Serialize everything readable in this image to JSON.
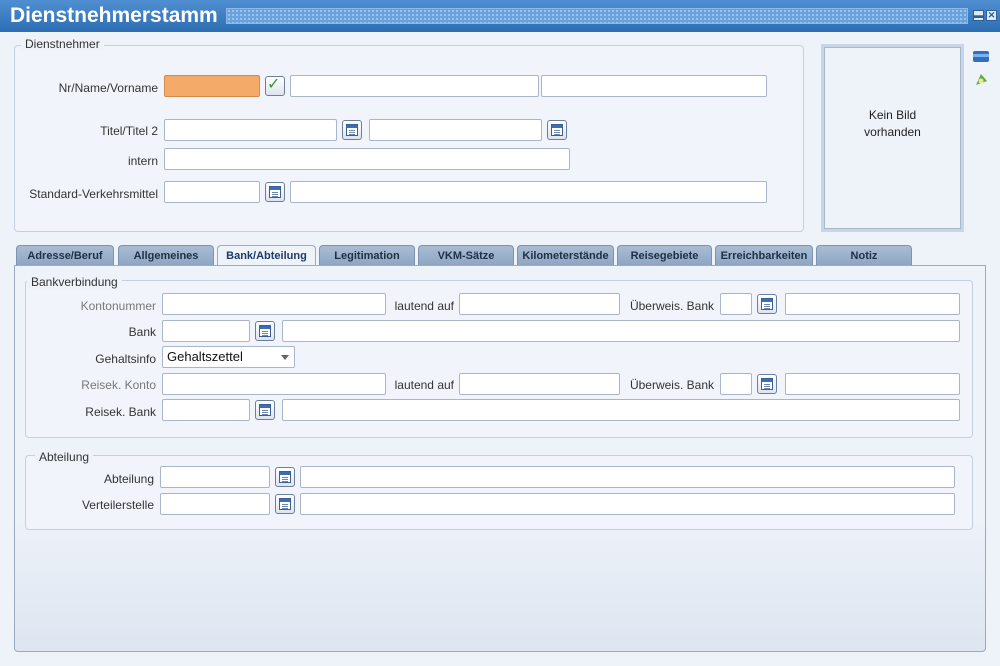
{
  "window": {
    "title": "Dienstnehmerstamm"
  },
  "titlebar": {
    "minimize_glyph": "▬",
    "close_glyph": "✕"
  },
  "dienstnehmer": {
    "legend": "Dienstnehmer",
    "nr_name_vorname_label": "Nr/Name/Vorname",
    "titel_label": "Titel/Titel 2",
    "intern_label": "intern",
    "verkehrsmittel_label": "Standard-Verkehrsmittel",
    "nr_value": "",
    "name_value": "",
    "vorname_value": "",
    "titel_value": "",
    "titel2_value": "",
    "intern_value": "",
    "verkehrsmittel_code": "",
    "verkehrsmittel_text": ""
  },
  "photo": {
    "line1": "Kein Bild",
    "line2": "vorhanden"
  },
  "tabs": [
    {
      "label": "Adresse/Beruf",
      "active": false
    },
    {
      "label": "Allgemeines",
      "active": false
    },
    {
      "label": "Bank/Abteilung",
      "active": true
    },
    {
      "label": "Legitimation",
      "active": false
    },
    {
      "label": "VKM-Sätze",
      "active": false
    },
    {
      "label": "Kilometerstände",
      "active": false
    },
    {
      "label": "Reisegebiete",
      "active": false
    },
    {
      "label": "Erreichbarkeiten",
      "active": false
    },
    {
      "label": "Notiz",
      "active": false
    }
  ],
  "bankverbindung": {
    "legend": "Bankverbindung",
    "kontonummer_label": "Kontonummer",
    "lautend_auf_label": "lautend auf",
    "ueberweis_bank_label": "Überweis. Bank",
    "bank_label": "Bank",
    "gehaltsinfo_label": "Gehaltsinfo",
    "gehaltsinfo_value": "Gehaltszettel",
    "reisek_konto_label": "Reisek. Konto",
    "reisek_lautend_auf_label": "lautend auf",
    "reisek_ueberweis_bank_label": "Überweis. Bank",
    "reisek_bank_label": "Reisek. Bank"
  },
  "abteilung": {
    "legend": "Abteilung",
    "abteilung_label": "Abteilung",
    "verteilerstelle_label": "Verteilerstelle"
  },
  "icons": {
    "lookup": "calendar-list-icon",
    "confirm": "green-check-icon",
    "side_top": "folder-icon",
    "side_bottom": "paint-icon"
  },
  "colors": {
    "titlebar": "#2d6db3",
    "active_field": "#f4aa68",
    "tab_inactive": "#8ea6c3",
    "background": "#eef2f9"
  }
}
